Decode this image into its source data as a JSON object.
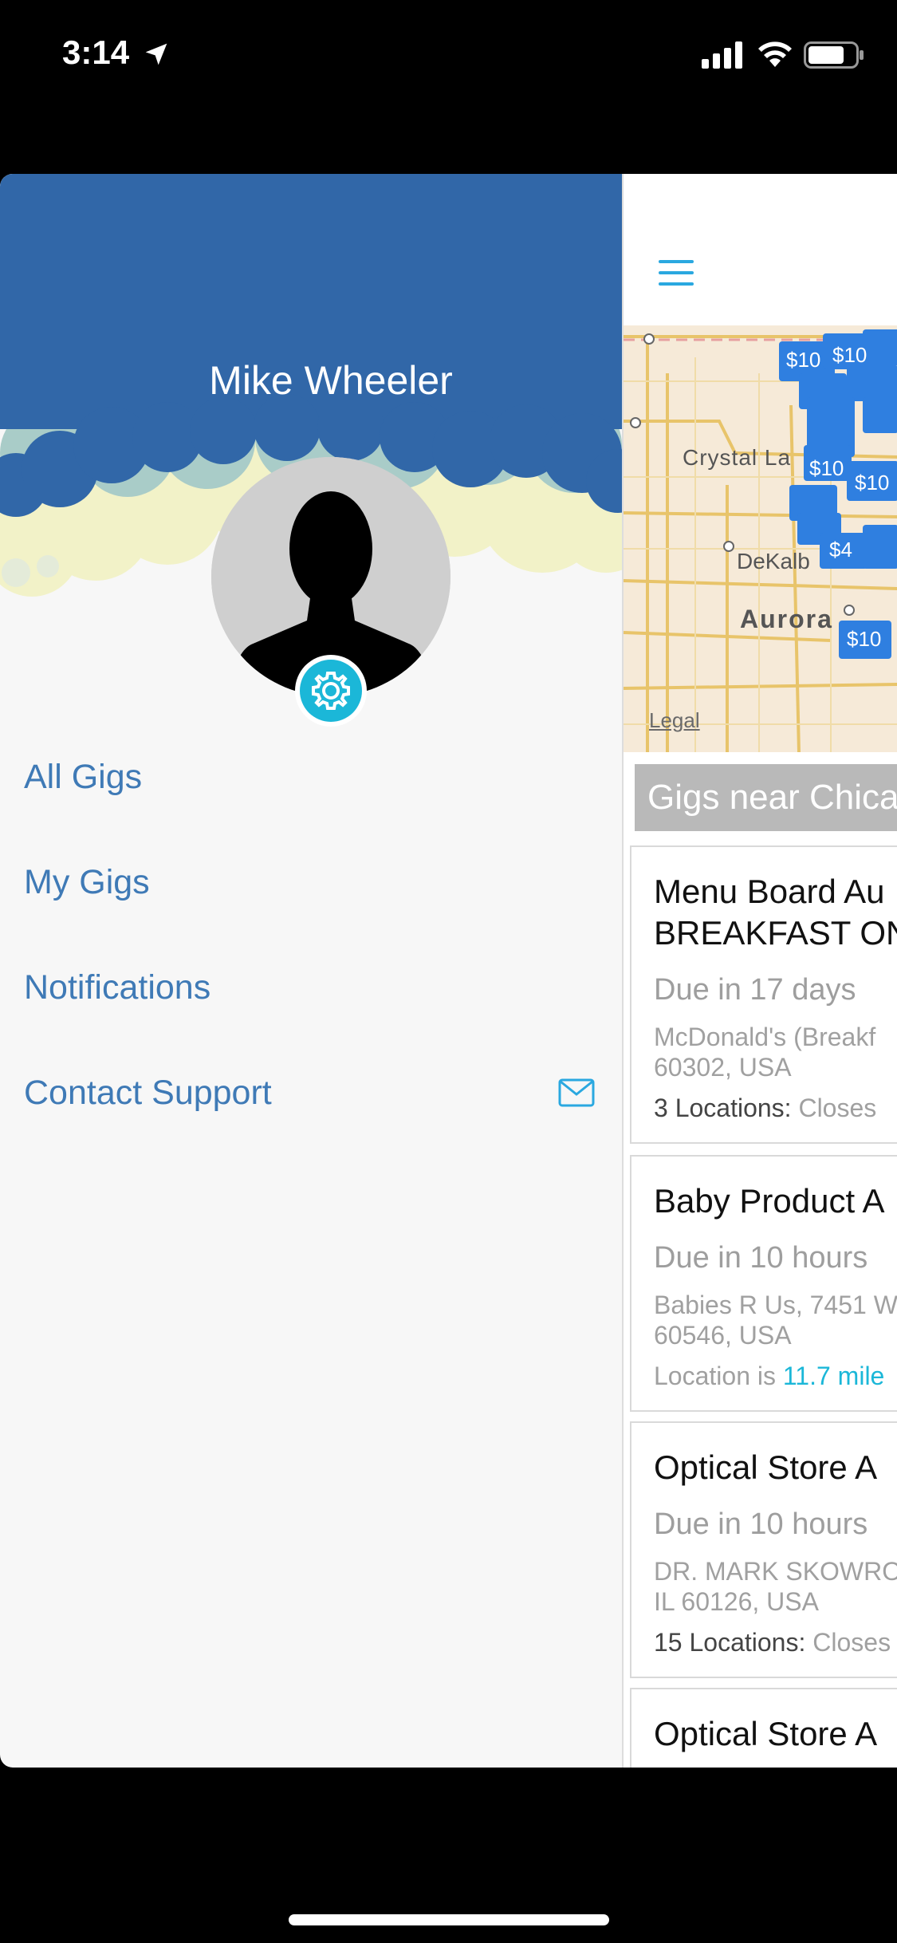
{
  "status_bar": {
    "time": "3:14"
  },
  "drawer": {
    "user_name": "Mike Wheeler",
    "menu": [
      {
        "label": "All Gigs"
      },
      {
        "label": "My Gigs"
      },
      {
        "label": "Notifications"
      },
      {
        "label": "Contact Support"
      }
    ]
  },
  "map": {
    "labels": {
      "crystal_lake": "Crystal La",
      "dekalb": "DeKalb",
      "aurora": "Aurora"
    },
    "legal": "Legal",
    "pins": [
      "$10",
      "$10",
      "$10",
      "$10",
      "$4",
      "$10",
      "$10",
      "$10"
    ]
  },
  "gigs": {
    "heading": "Gigs near Chica",
    "cards": [
      {
        "title_line1": "Menu Board Au",
        "title_line2": "BREAKFAST ON",
        "due": "Due in 17 days",
        "addr_line1": "McDonald's (Breakf",
        "addr_line2": "60302, USA",
        "foot_label": "3 Locations:",
        "foot_value": "Closes"
      },
      {
        "title_line1": "Baby Product A",
        "due": "Due in 10 hours",
        "addr_line1": "Babies R Us, 7451 W",
        "addr_line2": "60546, USA",
        "foot_label": "Location is",
        "foot_value": "11.7 mile"
      },
      {
        "title_line1": "Optical Store A",
        "due": "Due in 10 hours",
        "addr_line1": "DR. MARK SKOWRO",
        "addr_line2": "IL 60126, USA",
        "foot_label": "15 Locations:",
        "foot_value": "Closes"
      },
      {
        "title_line1": "Optical Store A"
      }
    ]
  },
  "colors": {
    "header_blue": "#3167a8",
    "link_blue": "#3f7ab6",
    "accent_cyan": "#1bb7d8",
    "pin_blue": "#2f7fe0"
  }
}
